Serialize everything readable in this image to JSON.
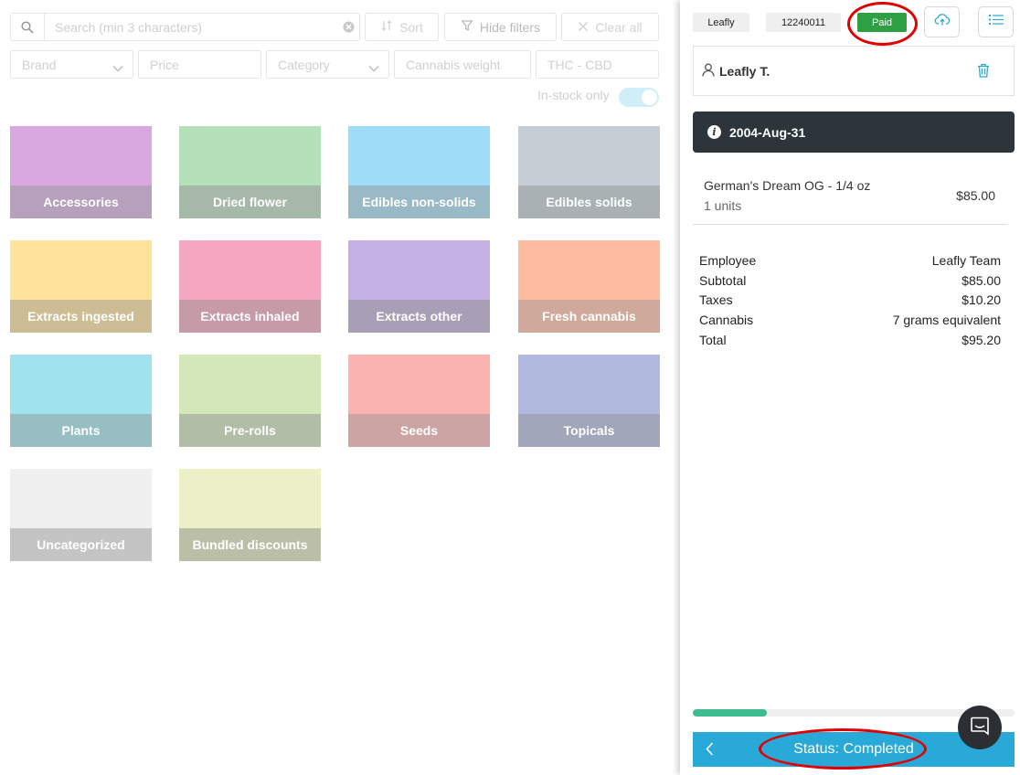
{
  "toolbar": {
    "search_placeholder": "Search (min 3 characters)",
    "sort_label": "Sort",
    "hide_filters_label": "Hide filters",
    "clear_all_label": "Clear all"
  },
  "filters": {
    "brand": "Brand",
    "price": "Price",
    "category": "Category",
    "cannabis_weight": "Cannabis weight",
    "thc_cbd": "THC - CBD",
    "in_stock_label": "In-stock only",
    "in_stock_on": true
  },
  "categories": [
    {
      "label": "Accessories",
      "top": "#d8a9de",
      "bar": "#b6a0bb"
    },
    {
      "label": "Dried flower",
      "top": "#b6e0b9",
      "bar": "#a6b8a7"
    },
    {
      "label": "Edibles non-solids",
      "top": "#9fdcf7",
      "bar": "#9ab9c7"
    },
    {
      "label": "Edibles solids",
      "top": "#c3cdd3",
      "bar": "#aab1b5"
    },
    {
      "label": "Extracts ingested",
      "top": "#fde49a",
      "bar": "#cdbd94"
    },
    {
      "label": "Extracts inhaled",
      "top": "#f5a6c1",
      "bar": "#c79aa8"
    },
    {
      "label": "Extracts other",
      "top": "#c5b0e3",
      "bar": "#a89fb6"
    },
    {
      "label": "Fresh cannabis",
      "top": "#ffbba2",
      "bar": "#cfaa9c"
    },
    {
      "label": "Plants",
      "top": "#a0e2ed",
      "bar": "#97bec2"
    },
    {
      "label": "Pre-rolls",
      "top": "#d4e7b8",
      "bar": "#b2bda7"
    },
    {
      "label": "Seeds",
      "top": "#fab3b1",
      "bar": "#cca4a3"
    },
    {
      "label": "Topicals",
      "top": "#b1b9df",
      "bar": "#a2a6ba"
    },
    {
      "label": "Uncategorized",
      "top": "#f0f0f0",
      "bar": "#c4c4c4"
    },
    {
      "label": "Bundled discounts",
      "top": "#ecf0c6",
      "bar": "#bcbfa8"
    }
  ],
  "order": {
    "store_chip": "Leafly",
    "order_number": "12240011",
    "payment_status": "Paid",
    "customer_name": "Leafly T.",
    "date": "2004-Aug-31",
    "items": [
      {
        "name": "German's Dream OG - 1/4 oz",
        "units": "1 units",
        "price": "$85.00"
      }
    ],
    "summary": [
      {
        "label": "Employee",
        "value": "Leafly Team"
      },
      {
        "label": "Subtotal",
        "value": "$85.00"
      },
      {
        "label": "Taxes",
        "value": "$10.20"
      },
      {
        "label": "Cannabis",
        "value": "7 grams equivalent"
      },
      {
        "label": "Total",
        "value": "$95.20"
      }
    ],
    "progress_fraction": 0.23,
    "status_label": "Status: Completed"
  },
  "colors": {
    "accent": "#29a9d8",
    "paid": "#2ea043",
    "highlight_ring": "#e00000",
    "date_bar": "#2d343a"
  }
}
